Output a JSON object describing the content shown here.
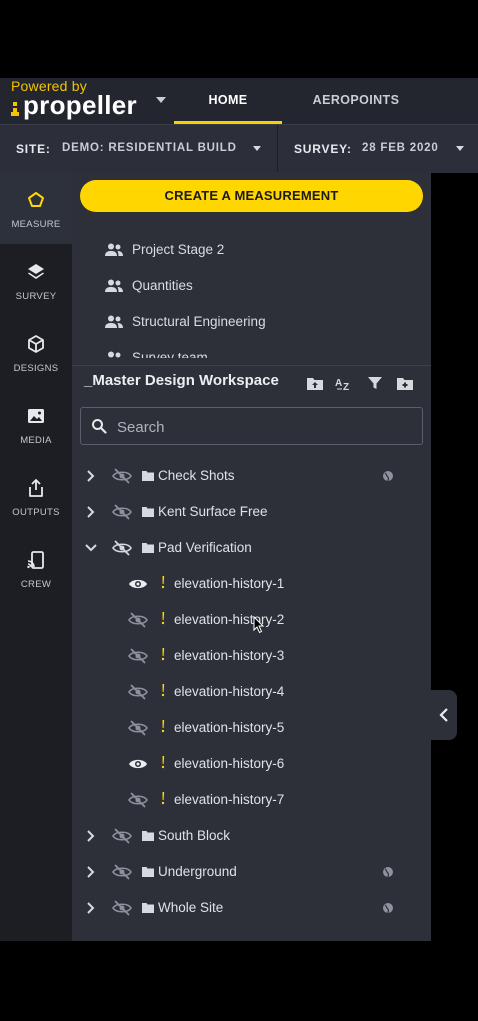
{
  "brand": {
    "powered_by": "Powered by",
    "name": "propeller"
  },
  "nav": {
    "tabs": [
      {
        "label": "HOME",
        "active": true
      },
      {
        "label": "AEROPOINTS",
        "active": false
      }
    ]
  },
  "sitebar": {
    "site_label": "SITE:",
    "site_value": "DEMO: RESIDENTIAL BUILD",
    "survey_label": "SURVEY:",
    "survey_value": "28 FEB 2020"
  },
  "rail": {
    "items": [
      {
        "label": "MEASURE",
        "icon": "measure-icon",
        "active": true
      },
      {
        "label": "SURVEY",
        "icon": "layers-icon",
        "active": false
      },
      {
        "label": "DESIGNS",
        "icon": "cube-icon",
        "active": false
      },
      {
        "label": "MEDIA",
        "icon": "image-icon",
        "active": false
      },
      {
        "label": "OUTPUTS",
        "icon": "share-icon",
        "active": false
      },
      {
        "label": "CREW",
        "icon": "cast-icon",
        "active": false
      }
    ]
  },
  "panel": {
    "cta_label": "CREATE A MEASUREMENT",
    "teams": [
      "Project Stage 2",
      "Quantities",
      "Structural Engineering",
      "Survey team"
    ],
    "workspace_title": "_Master Design Workspace",
    "search": {
      "placeholder": "Search",
      "value": ""
    },
    "tree": {
      "folders_top": [
        {
          "name": "Check Shots",
          "expanded": false,
          "shared": true
        },
        {
          "name": "Kent Surface Free",
          "expanded": false,
          "shared": false
        },
        {
          "name": "Pad Verification",
          "expanded": true,
          "shared": false
        }
      ],
      "children": [
        {
          "name": "elevation-history-1",
          "visible": true
        },
        {
          "name": "elevation-history-2",
          "visible": false
        },
        {
          "name": "elevation-history-3",
          "visible": false
        },
        {
          "name": "elevation-history-4",
          "visible": false
        },
        {
          "name": "elevation-history-5",
          "visible": false
        },
        {
          "name": "elevation-history-6",
          "visible": true
        },
        {
          "name": "elevation-history-7",
          "visible": false
        }
      ],
      "folders_bottom": [
        {
          "name": "South Block",
          "expanded": false,
          "shared": false
        },
        {
          "name": "Underground",
          "expanded": false,
          "shared": true
        },
        {
          "name": "Whole Site",
          "expanded": false,
          "shared": true
        }
      ]
    }
  },
  "colors": {
    "accent": "#ffd600",
    "rail_bg": "#1c1e24",
    "panel_bg": "#2d3039",
    "topbar_bg": "#23262f"
  }
}
